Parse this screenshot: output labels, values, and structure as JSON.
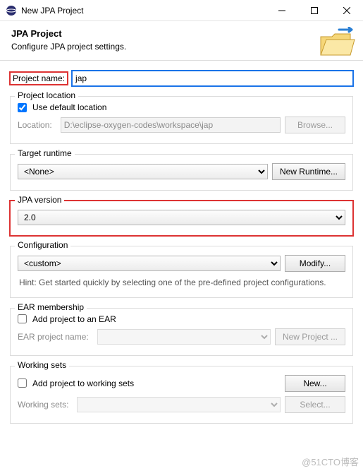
{
  "titlebar": {
    "title": "New JPA Project"
  },
  "banner": {
    "heading": "JPA Project",
    "description": "Configure JPA project settings."
  },
  "projectName": {
    "label": "Project name:",
    "value": "jap"
  },
  "projectLocation": {
    "legend": "Project location",
    "useDefaultLabel": "Use default location",
    "useDefaultChecked": true,
    "locationLabel": "Location:",
    "locationValue": "D:\\eclipse-oxygen-codes\\workspace\\jap",
    "browseButton": "Browse..."
  },
  "targetRuntime": {
    "legend": "Target runtime",
    "selected": "<None>",
    "newRuntimeButton": "New Runtime..."
  },
  "jpaVersion": {
    "legend": "JPA version",
    "selected": "2.0"
  },
  "configuration": {
    "legend": "Configuration",
    "selected": "<custom>",
    "modifyButton": "Modify...",
    "hint": "Hint: Get started quickly by selecting one of the pre-defined project configurations."
  },
  "earMembership": {
    "legend": "EAR membership",
    "addToEarLabel": "Add project to an EAR",
    "addToEarChecked": false,
    "projectLabel": "EAR project name:",
    "projectValue": "",
    "newProjectButton": "New Project ..."
  },
  "workingSets": {
    "legend": "Working sets",
    "addToWsLabel": "Add project to working sets",
    "addToWsChecked": false,
    "newButton": "New...",
    "wsLabel": "Working sets:",
    "selectButton": "Select..."
  },
  "watermark": "@51CTO博客"
}
